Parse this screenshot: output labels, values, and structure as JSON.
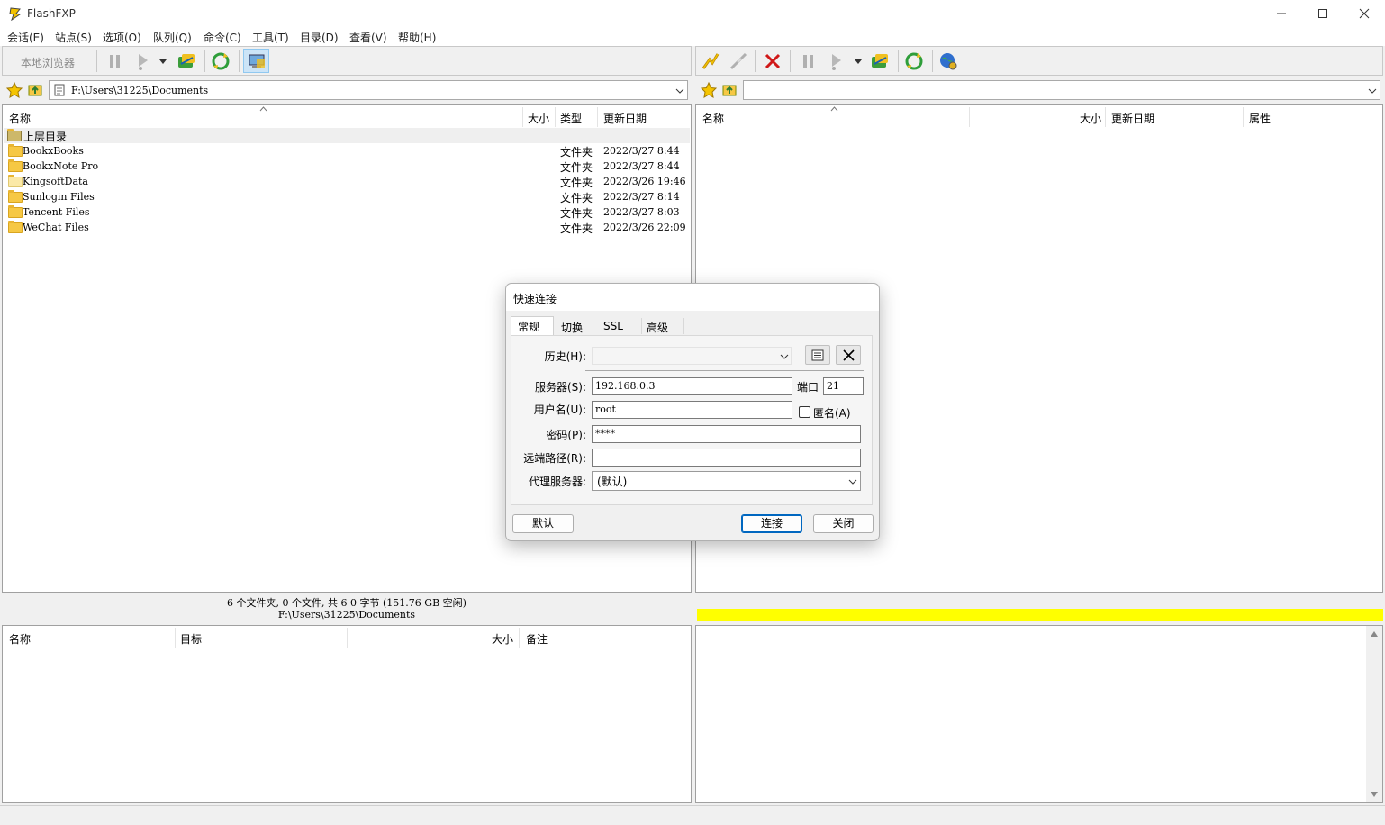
{
  "app": {
    "title": "FlashFXP"
  },
  "menu": [
    "会话(E)",
    "站点(S)",
    "选项(O)",
    "队列(Q)",
    "命令(C)",
    "工具(T)",
    "目录(D)",
    "查看(V)",
    "帮助(H)"
  ],
  "left": {
    "toolbar_label": "本地浏览器",
    "path": "F:\\Users\\31225\\Documents",
    "columns": [
      "名称",
      "大小",
      "类型",
      "更新日期"
    ],
    "parent_label": "上层目录",
    "files": [
      {
        "name": "BookxBooks",
        "type": "文件夹",
        "date": "2022/3/27 8:44"
      },
      {
        "name": "BookxNote Pro",
        "type": "文件夹",
        "date": "2022/3/27 8:44"
      },
      {
        "name": "KingsoftData",
        "type": "文件夹",
        "date": "2022/3/26 19:46"
      },
      {
        "name": "Sunlogin Files",
        "type": "文件夹",
        "date": "2022/3/27 8:14"
      },
      {
        "name": "Tencent Files",
        "type": "文件夹",
        "date": "2022/3/27 8:03"
      },
      {
        "name": "WeChat Files",
        "type": "文件夹",
        "date": "2022/3/26 22:09"
      }
    ],
    "status_line1": "6 个文件夹, 0 个文件, 共 6 0 字节 (151.76 GB 空闲)",
    "status_line2": "F:\\Users\\31225\\Documents"
  },
  "right": {
    "path": "",
    "columns": [
      "名称",
      "大小",
      "更新日期",
      "属性"
    ]
  },
  "queue": {
    "columns": [
      "名称",
      "目标",
      "大小",
      "备注"
    ]
  },
  "dialog": {
    "title": "快速连接",
    "tabs": [
      "常规",
      "切换",
      "SSL",
      "高级"
    ],
    "history_label": "历史(H):",
    "server_label": "服务器(S):",
    "server_value": "192.168.0.3",
    "port_label": "端口",
    "port_value": "21",
    "user_label": "用户名(U):",
    "user_value": "root",
    "anon_label": "匿名(A)",
    "password_label": "密码(P):",
    "password_value": "****",
    "remote_path_label": "远端路径(R):",
    "remote_path_value": "",
    "proxy_label": "代理服务器:",
    "proxy_value": "(默认)",
    "default_button": "默认",
    "connect_button": "连接",
    "close_button": "关闭"
  },
  "colors": {
    "transfer_bar": "#ffff00",
    "folder": "#f6c844"
  }
}
